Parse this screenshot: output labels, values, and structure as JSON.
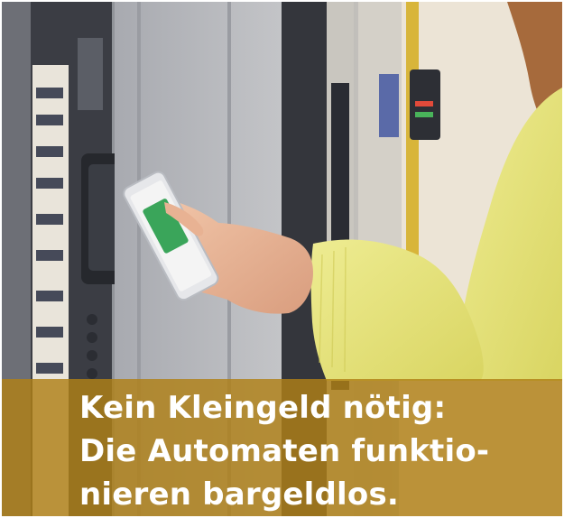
{
  "caption": {
    "line1": "Kein Kleingeld nötig:",
    "line2": "Die Automaten funktio-",
    "line3": "nieren bargeldlos."
  },
  "colors": {
    "caption_band": "#b08016",
    "caption_text": "#ffffff",
    "sweater": "#e4e27a",
    "hair": "#a66a3c"
  }
}
